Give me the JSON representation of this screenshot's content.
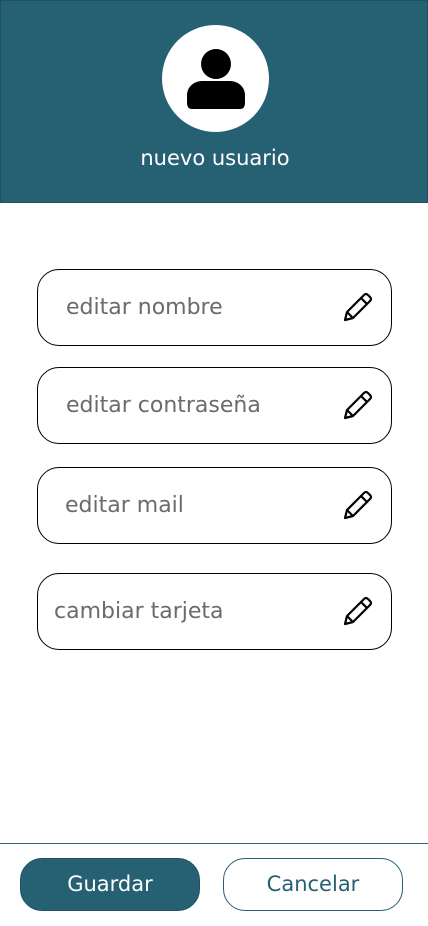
{
  "header": {
    "title": "nuevo usuario",
    "avatar_icon": "user-silhouette-icon",
    "background_color": "#266173"
  },
  "form": {
    "fields": [
      {
        "label": "editar nombre",
        "icon": "pencil-icon"
      },
      {
        "label": "editar contraseña",
        "icon": "pencil-icon"
      },
      {
        "label": "editar mail",
        "icon": "pencil-icon"
      },
      {
        "label": "cambiar tarjeta",
        "icon": "pencil-icon"
      }
    ]
  },
  "footer": {
    "save_label": "Guardar",
    "cancel_label": "Cancelar",
    "accent_color": "#266173"
  }
}
